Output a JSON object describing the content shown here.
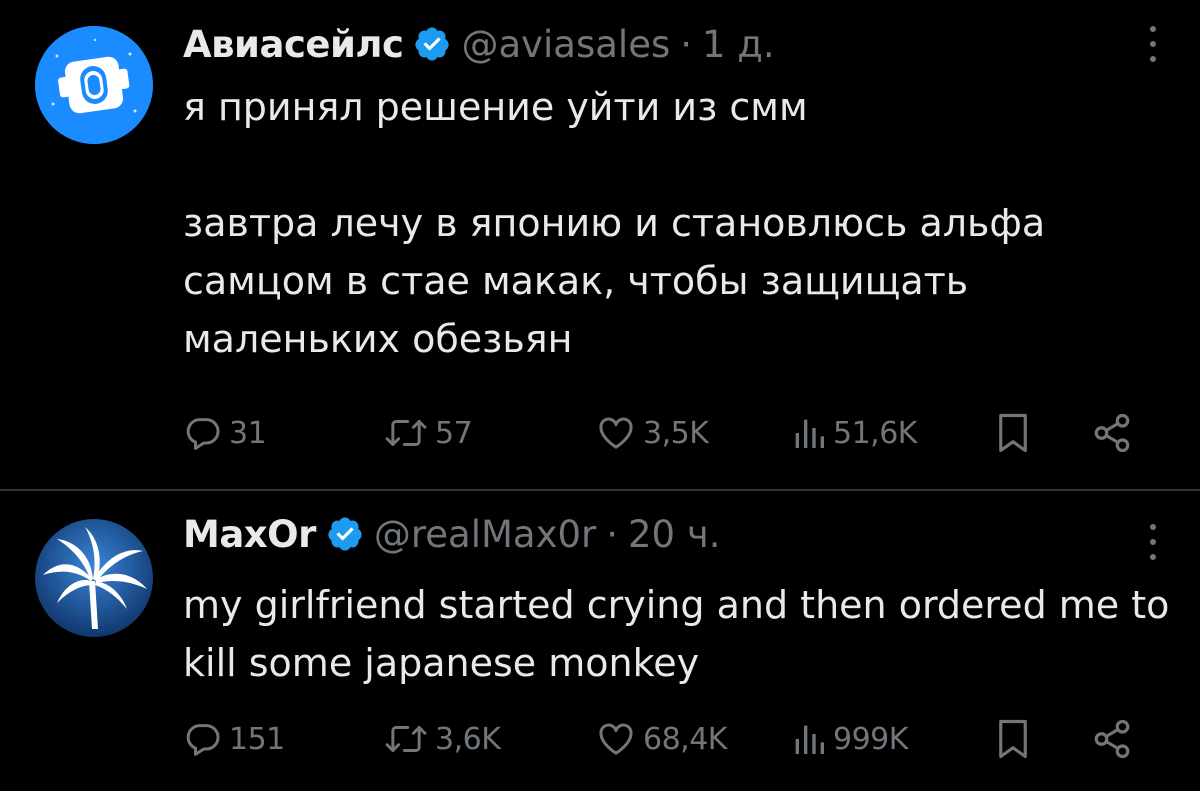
{
  "tweets": [
    {
      "name": "Авиасейлс",
      "handle": "@aviasales",
      "separator": "·",
      "time": "1 д.",
      "text": "я принял решение уйти из смм\n\nзавтра лечу в японию и становлюсь альфа самцом в стае макак, чтобы защищать маленьких обезьян",
      "avatar_icon": "aviasales-logo-icon",
      "stats": {
        "replies": "31",
        "reposts": "57",
        "likes": "3,5K",
        "views": "51,6K"
      }
    },
    {
      "name": "MaxOr",
      "handle": "@realMax0r",
      "separator": "·",
      "time": "20 ч.",
      "text": "my girlfriend started crying and then ordered me to kill some japanese monkey",
      "avatar_icon": "palm-tree-avatar-icon",
      "stats": {
        "replies": "151",
        "reposts": "3,6K",
        "likes": "68,4K",
        "views": "999K"
      }
    }
  ],
  "colors": {
    "background": "#000000",
    "text": "#e7e9ea",
    "muted": "#71767b",
    "verified": "#1d9bf0",
    "divider": "#2f3336"
  }
}
